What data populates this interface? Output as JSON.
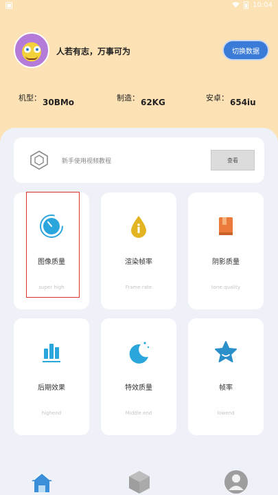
{
  "status_bar": {
    "left_glyph": "■",
    "time": "10:04"
  },
  "profile": {
    "motto": "人若有志，万事可为",
    "switch_button": "切换数据"
  },
  "specs": [
    {
      "label": "机型：",
      "value": "30BMo"
    },
    {
      "label": "制造：",
      "value": "62KG"
    },
    {
      "label": "安卓：",
      "value": "654iu"
    }
  ],
  "tutorial": {
    "text": "新手使用视频教程",
    "button": "查看"
  },
  "cards": [
    {
      "title": "图像质量",
      "subtitle": "super high",
      "icon": "clock-icon",
      "color": "#2ba6dd"
    },
    {
      "title": "渲染帧率",
      "subtitle": "Frame rate",
      "icon": "drop-icon",
      "color": "#e3b422"
    },
    {
      "title": "阴影质量",
      "subtitle": "tone quality",
      "icon": "book-icon",
      "color": "#ec7b3b"
    },
    {
      "title": "后期效果",
      "subtitle": "highend",
      "icon": "bars-icon",
      "color": "#2ba6dd"
    },
    {
      "title": "特效质量",
      "subtitle": "Middle end",
      "icon": "moon-icon",
      "color": "#2ba6dd"
    },
    {
      "title": "帧率",
      "subtitle": "lowend",
      "icon": "star-icon",
      "color": "#2b8fc9"
    }
  ],
  "nav": [
    "home-icon",
    "cube-icon",
    "user-icon"
  ]
}
